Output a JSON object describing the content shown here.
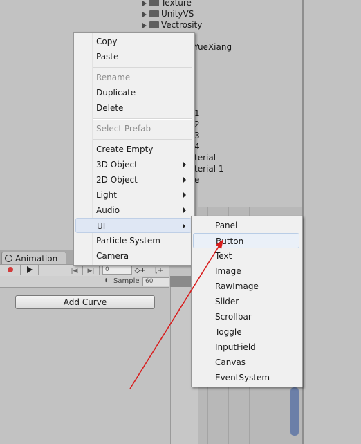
{
  "project": {
    "folders": [
      {
        "name": "Texture"
      },
      {
        "name": "UnityVS"
      },
      {
        "name": "Vectrosity"
      }
    ],
    "partial_items": [
      "YueXiang",
      "1",
      "2",
      "3",
      "4",
      "terial",
      "terial 1",
      "e"
    ]
  },
  "animation": {
    "tab_label": "Animation",
    "frame_value": "0",
    "sample_label": "Sample",
    "sample_value": "60",
    "add_curve_label": "Add Curve"
  },
  "context_menu": {
    "items": [
      {
        "label": "Copy",
        "enabled": true
      },
      {
        "label": "Paste",
        "enabled": true
      },
      {
        "label": "Rename",
        "enabled": false
      },
      {
        "label": "Duplicate",
        "enabled": true
      },
      {
        "label": "Delete",
        "enabled": true
      },
      {
        "label": "Select Prefab",
        "enabled": false
      },
      {
        "label": "Create Empty",
        "enabled": true
      },
      {
        "label": "3D Object",
        "enabled": true,
        "submenu": true
      },
      {
        "label": "2D Object",
        "enabled": true,
        "submenu": true
      },
      {
        "label": "Light",
        "enabled": true,
        "submenu": true
      },
      {
        "label": "Audio",
        "enabled": true,
        "submenu": true
      },
      {
        "label": "UI",
        "enabled": true,
        "submenu": true,
        "highlighted": true
      },
      {
        "label": "Particle System",
        "enabled": true
      },
      {
        "label": "Camera",
        "enabled": true
      }
    ]
  },
  "ui_submenu": {
    "items": [
      {
        "label": "Panel"
      },
      {
        "label": "Button",
        "highlighted": true
      },
      {
        "label": "Text"
      },
      {
        "label": "Image"
      },
      {
        "label": "RawImage"
      },
      {
        "label": "Slider"
      },
      {
        "label": "Scrollbar"
      },
      {
        "label": "Toggle"
      },
      {
        "label": "InputField"
      },
      {
        "label": "Canvas"
      },
      {
        "label": "EventSystem"
      }
    ]
  },
  "colors": {
    "annotation_arrow": "#d81f1f",
    "menu_highlight": "#dfe7f4",
    "record_dot": "#d23a3a"
  }
}
